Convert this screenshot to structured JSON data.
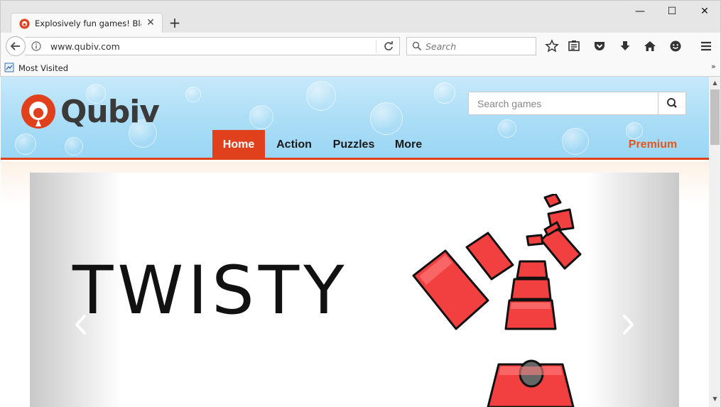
{
  "browser": {
    "tab_title": "Explosively fun games! Bla…",
    "url": "www.qubiv.com",
    "search_placeholder": "Search",
    "bookmarks": [
      "Most Visited"
    ],
    "bookmarks_overflow": "»",
    "window_controls": {
      "minimize": "—",
      "maximize": "☐",
      "close": "✕"
    }
  },
  "site": {
    "logo_text": "Qubiv",
    "search_placeholder": "Search games",
    "nav": [
      "Home",
      "Action",
      "Puzzles",
      "More"
    ],
    "premium": "Premium",
    "active_nav": "Home"
  },
  "slider": {
    "title": "TWISTY"
  },
  "colors": {
    "brand_orange": "#e1401d",
    "premium_orange": "#e1581d",
    "header_blue": "#a8dcf6",
    "block_red": "#f24040"
  }
}
